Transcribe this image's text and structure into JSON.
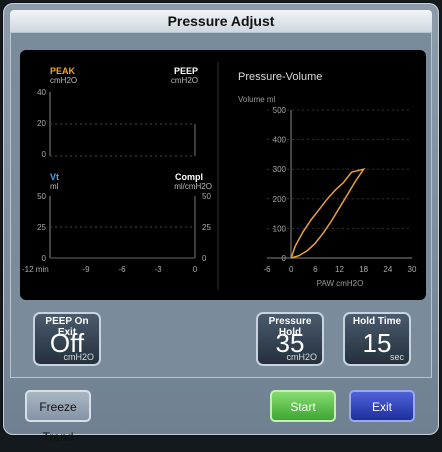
{
  "dialog": {
    "title": "Pressure Adjust"
  },
  "trends": {
    "top": {
      "left_label": "PEAK",
      "left_unit": "cmH2O",
      "right_label": "PEEP",
      "right_unit": "cmH2O",
      "yticks": [
        "40",
        "20",
        "0"
      ]
    },
    "bottom": {
      "left_label": "Vt",
      "left_unit": "ml",
      "right_label": "Compl",
      "right_unit": "ml/cmH2O",
      "yticks": [
        "50",
        "25",
        "0"
      ]
    },
    "xticks": [
      "-12 min",
      "-9",
      "-6",
      "-3",
      "0"
    ]
  },
  "pv_loop": {
    "title": "Pressure-Volume",
    "ylabel": "Volume  ml",
    "xlabel": "PAW  cmH2O",
    "yticks": [
      "500",
      "400",
      "300",
      "200",
      "100",
      "0"
    ],
    "xticks": [
      "-6",
      "0",
      "6",
      "12",
      "18",
      "24",
      "30"
    ]
  },
  "chart_data": {
    "type": "line",
    "title": "Pressure-Volume",
    "xlabel": "PAW  cmH2O",
    "ylabel": "Volume  ml",
    "xlim": [
      -6,
      30
    ],
    "ylim": [
      0,
      500
    ],
    "series": [
      {
        "x": [
          0,
          1,
          3,
          5,
          7,
          9,
          11,
          13,
          15,
          18,
          18,
          16,
          14,
          12,
          10,
          8,
          6,
          4,
          2,
          0
        ],
        "y": [
          0,
          40,
          90,
          130,
          165,
          200,
          230,
          255,
          290,
          300,
          300,
          260,
          215,
          170,
          125,
          85,
          50,
          25,
          8,
          0
        ]
      }
    ],
    "color": "#e8a040"
  },
  "tiles": {
    "peep_on_exit": {
      "label": "PEEP On Exit",
      "value": "Off",
      "unit": "cmH2O"
    },
    "pressure_hold": {
      "label": "Pressure Hold",
      "value": "35",
      "unit": "cmH2O"
    },
    "hold_time": {
      "label": "Hold Time",
      "value": "15",
      "unit": "sec"
    }
  },
  "buttons": {
    "freeze": "Freeze Trend",
    "start": "Start",
    "exit": "Exit"
  },
  "colors": {
    "peak": "#f5a623",
    "vt": "#4aa3ff",
    "loop": "#e8a040",
    "start": "#4fb83d",
    "exit": "#2a3fb8"
  }
}
